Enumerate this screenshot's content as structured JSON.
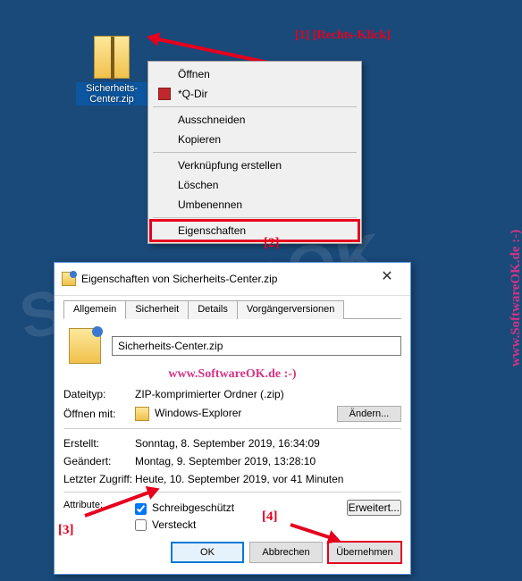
{
  "desktop": {
    "file_label": "Sicherheits-Center.zip"
  },
  "annotations": {
    "step1": "[1]  [Rechts-Klick]",
    "step2": "[2]",
    "step3": "[3]",
    "step4": "[4]"
  },
  "context_menu": {
    "open": "Öffnen",
    "qdir": "*Q-Dir",
    "cut": "Ausschneiden",
    "copy": "Kopieren",
    "shortcut": "Verknüpfung erstellen",
    "delete": "Löschen",
    "rename": "Umbenennen",
    "properties": "Eigenschaften"
  },
  "dialog": {
    "title": "Eigenschaften von Sicherheits-Center.zip",
    "tabs": {
      "general": "Allgemein",
      "security": "Sicherheit",
      "details": "Details",
      "prev": "Vorgängerversionen"
    },
    "filename": "Sicherheits-Center.zip",
    "watermark_inline": "www.SoftwareOK.de  :-)",
    "labels": {
      "type": "Dateityp:",
      "openwith": "Öffnen mit:",
      "created": "Erstellt:",
      "modified": "Geändert:",
      "accessed": "Letzter Zugriff:",
      "attributes": "Attribute:"
    },
    "values": {
      "type": "ZIP-komprimierter Ordner (.zip)",
      "openwith": "Windows-Explorer",
      "created": "Sonntag, 8. September 2019, 16:34:09",
      "modified": "Montag, 9. September 2019, 13:28:10",
      "accessed": "Heute, 10. September 2019, vor 41 Minuten"
    },
    "attrs": {
      "readonly": "Schreibgeschützt",
      "hidden": "Versteckt"
    },
    "buttons": {
      "change": "Ändern...",
      "advanced": "Erweitert...",
      "ok": "OK",
      "cancel": "Abbrechen",
      "apply": "Übernehmen"
    }
  },
  "watermarks": {
    "side": "www.SoftwareOK.de  :-)",
    "big": "SoftwareOK"
  }
}
